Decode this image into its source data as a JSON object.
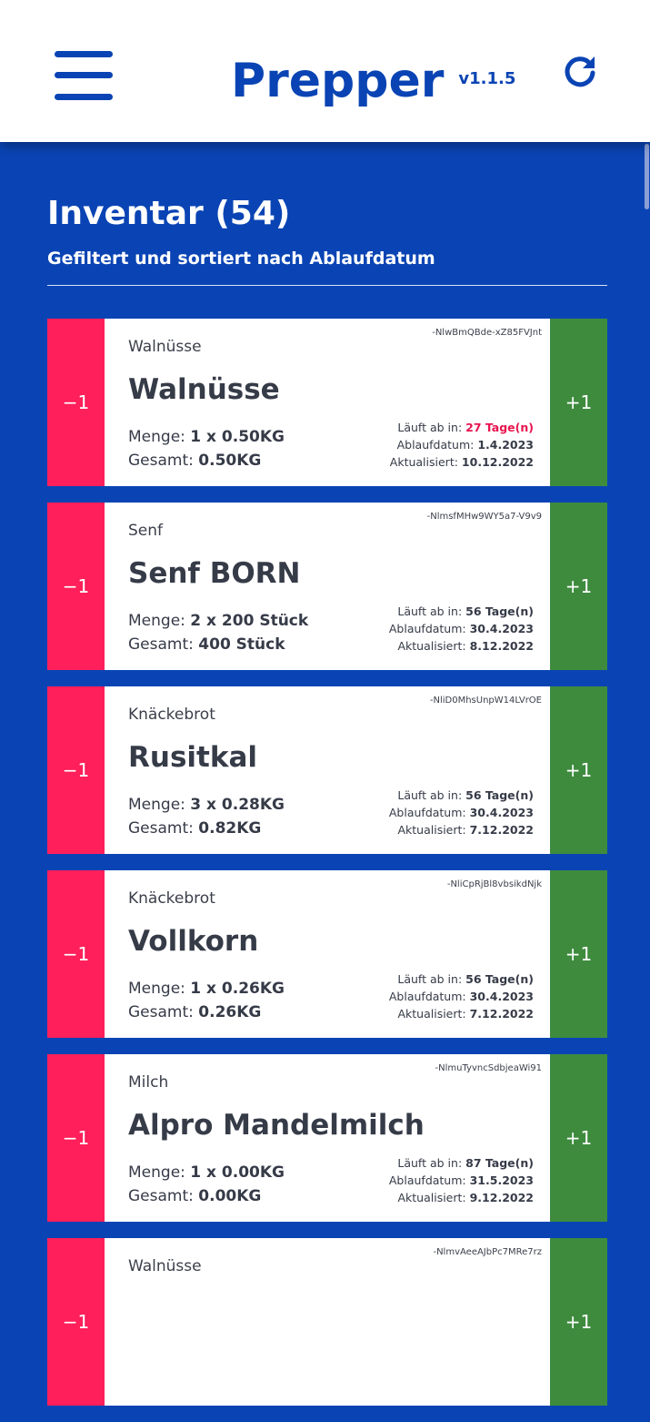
{
  "app": {
    "title": "Prepper",
    "version": "v1.1.5"
  },
  "colors": {
    "primary": "#0a44b4",
    "minus": "#ff1f5a",
    "plus": "#3e8b3e",
    "urgent": "#e8154f"
  },
  "icons": {
    "menu": "hamburger-menu-icon",
    "refresh": "refresh-icon"
  },
  "inventory": {
    "title": "Inventar (54)",
    "subtitle": "Gefiltert und sortiert nach Ablaufdatum",
    "labels": {
      "minus": "−1",
      "plus": "+1",
      "menge": "Menge:",
      "gesamt": "Gesamt:",
      "laeuft_ab": "Läuft ab in:",
      "ablaufdatum": "Ablaufdatum:",
      "aktualisiert": "Aktualisiert:"
    },
    "items": [
      {
        "id": "-NlwBmQBde-xZ85FVJnt",
        "category": "Walnüsse",
        "name": "Walnüsse",
        "menge": "1 x 0.50KG",
        "gesamt": "0.50KG",
        "laeuft_ab": "27 Tage(n)",
        "ablaufdatum": "1.4.2023",
        "aktualisiert": "10.12.2022",
        "urgent": true
      },
      {
        "id": "-NlmsfMHw9WY5a7-V9v9",
        "category": "Senf",
        "name": "Senf BORN",
        "menge": "2 x 200 Stück",
        "gesamt": "400 Stück",
        "laeuft_ab": "56 Tage(n)",
        "ablaufdatum": "30.4.2023",
        "aktualisiert": "8.12.2022",
        "urgent": false
      },
      {
        "id": "-NliD0MhsUnpW14LVrOE",
        "category": "Knäckebrot",
        "name": "Rusitkal",
        "menge": "3 x 0.28KG",
        "gesamt": "0.82KG",
        "laeuft_ab": "56 Tage(n)",
        "ablaufdatum": "30.4.2023",
        "aktualisiert": "7.12.2022",
        "urgent": false
      },
      {
        "id": "-NliCpRjBl8vbsikdNjk",
        "category": "Knäckebrot",
        "name": "Vollkorn",
        "menge": "1 x 0.26KG",
        "gesamt": "0.26KG",
        "laeuft_ab": "56 Tage(n)",
        "ablaufdatum": "30.4.2023",
        "aktualisiert": "7.12.2022",
        "urgent": false
      },
      {
        "id": "-NlmuTyvncSdbjeaWi91",
        "category": "Milch",
        "name": "Alpro Mandelmilch",
        "menge": "1 x 0.00KG",
        "gesamt": "0.00KG",
        "laeuft_ab": "87 Tage(n)",
        "ablaufdatum": "31.5.2023",
        "aktualisiert": "9.12.2022",
        "urgent": false
      },
      {
        "id": "-NlmvAeeAJbPc7MRe7rz",
        "category": "Walnüsse",
        "name": "",
        "menge": "",
        "gesamt": "",
        "laeuft_ab": "",
        "ablaufdatum": "",
        "aktualisiert": "",
        "urgent": false
      }
    ]
  }
}
